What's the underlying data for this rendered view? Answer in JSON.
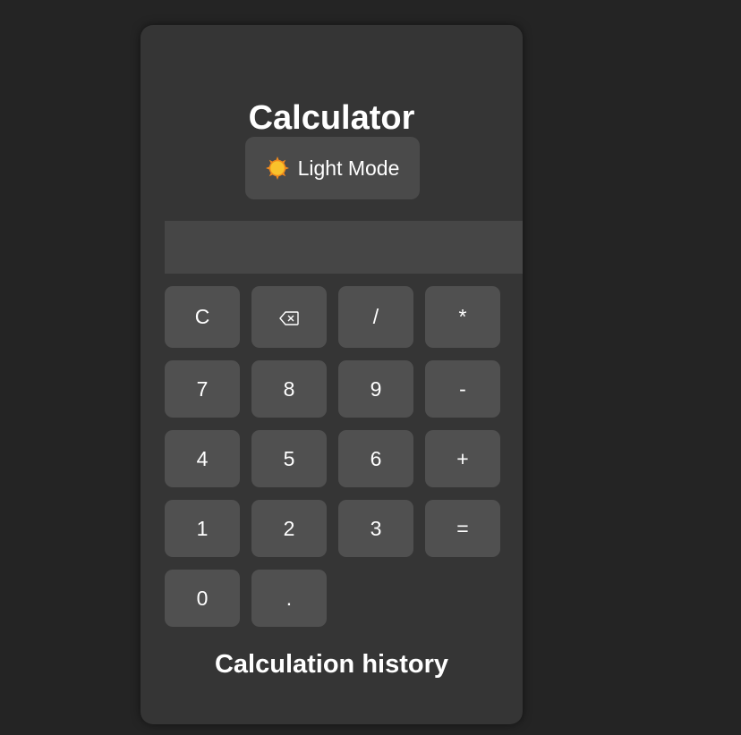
{
  "app": {
    "title": "Calculator",
    "theme_toggle_label": "Light Mode",
    "theme_toggle_icon": "sun-icon",
    "display_value": "",
    "history_title": "Calculation history"
  },
  "keys": {
    "clear": "C",
    "backspace": "⌫",
    "divide": "/",
    "multiply": "*",
    "seven": "7",
    "eight": "8",
    "nine": "9",
    "minus": "-",
    "four": "4",
    "five": "5",
    "six": "6",
    "plus": "+",
    "one": "1",
    "two": "2",
    "three": "3",
    "equals": "=",
    "zero": "0",
    "decimal": "."
  },
  "colors": {
    "page_bg": "#242424",
    "card_bg": "#353535",
    "key_bg": "#505050",
    "display_bg": "#464646",
    "toggle_bg": "#4a4a4a",
    "text": "#ffffff"
  }
}
